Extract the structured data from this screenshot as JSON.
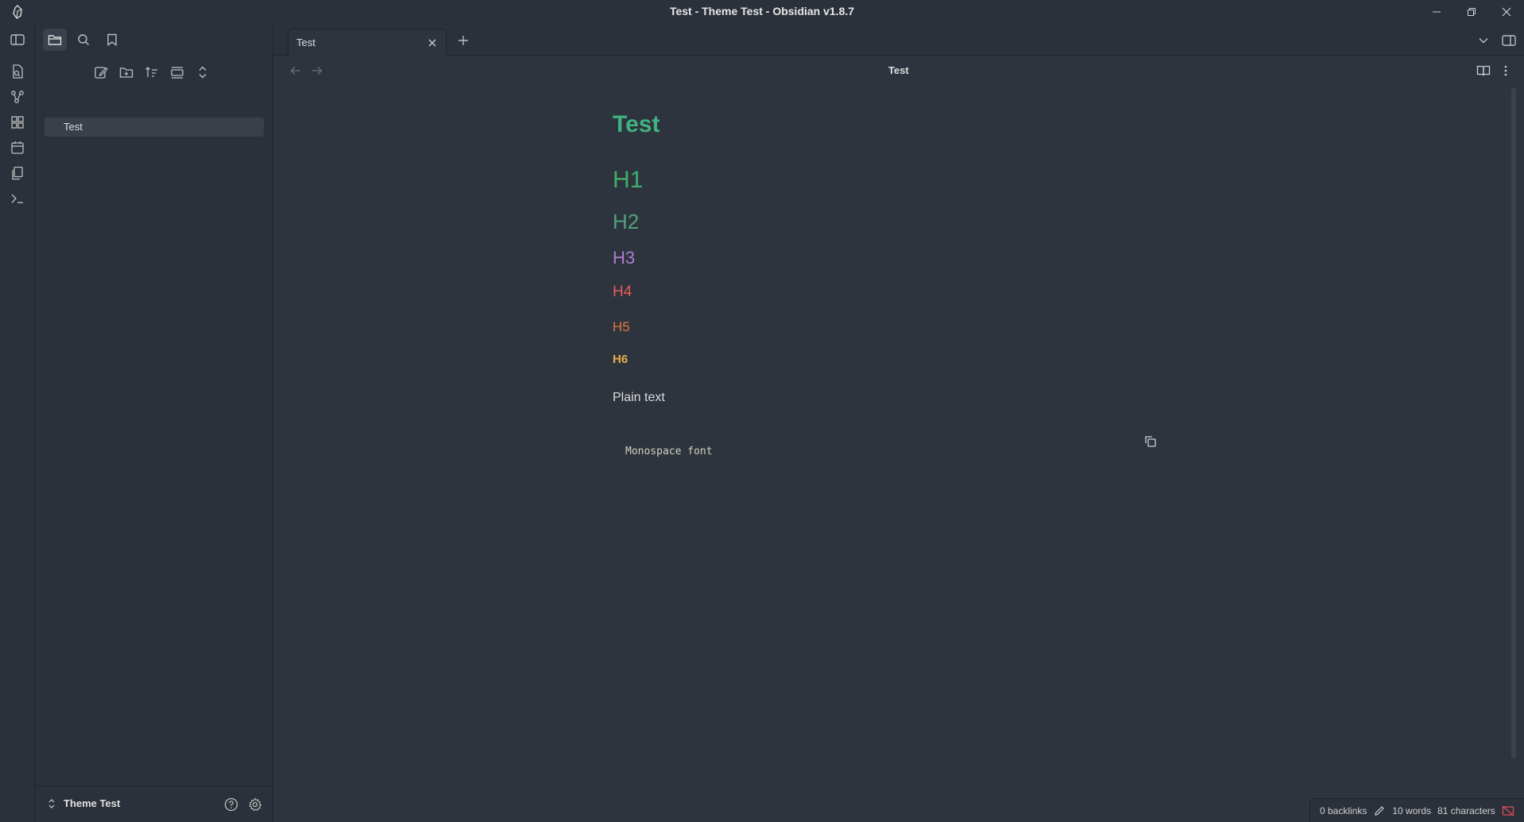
{
  "window": {
    "title": "Test - Theme Test - Obsidian v1.8.7"
  },
  "ribbon": {
    "items": [
      "open-quick-switcher",
      "open-graph-view",
      "open-canvas",
      "open-daily-note",
      "insert-template",
      "open-command-palette"
    ]
  },
  "sidebar": {
    "tabs": [
      "files",
      "search",
      "bookmarks"
    ],
    "active_tab": "files",
    "actions": [
      "new-note",
      "new-folder",
      "change-sort-order",
      "auto-reveal",
      "collapse-all"
    ],
    "files": [
      {
        "label": "Test"
      }
    ],
    "vault_name": "Theme Test"
  },
  "tabs": {
    "items": [
      {
        "label": "Test"
      }
    ]
  },
  "view": {
    "title": "Test"
  },
  "note": {
    "inline_title": "Test",
    "h1": "H1",
    "h2": "H2",
    "h3": "H3",
    "h4": "H4",
    "h5": "H5",
    "h6": "H6",
    "plain": "Plain text",
    "code": "Monospace font"
  },
  "statusbar": {
    "backlinks": "0 backlinks",
    "words": "10 words",
    "characters": "81 characters"
  },
  "colors": {
    "background": "#2e343e",
    "sidebar_bg": "#2b313a",
    "h1": "#3fae6a",
    "h2": "#50a37a",
    "h3": "#a97ecb",
    "h4": "#e45a5a",
    "h5": "#e0763c",
    "h6": "#e5b14a",
    "sync_error": "#e04a5a"
  }
}
